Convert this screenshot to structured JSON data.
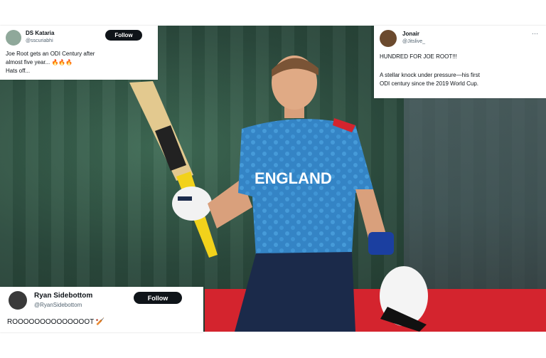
{
  "tweet_top_left": {
    "name": "DS Kataria",
    "verified_icon": "verified-badge-icon",
    "handle": "@sscuriabhi",
    "follow_label": "Follow",
    "text_line1": "Joe  Root gets an ODI Century after",
    "text_line2": "almost five year... 🔥🔥🔥",
    "text_line3": "Hats off..."
  },
  "tweet_top_right": {
    "name": "Jonair",
    "verified_icon": "verified-badge-icon",
    "handle": "@Jitslive_",
    "more_icon": "more-options-icon",
    "text_line1": "HUNDRED FOR JOE ROOT!!!",
    "text_line2": "A stellar knock under pressure—his first",
    "text_line3": "ODI century since the 2019 World Cup."
  },
  "tweet_bottom_left": {
    "name": "Ryan Sidebottom",
    "handle": "@RyanSidebottom",
    "follow_label": "Follow",
    "text": "ROOOOOOOOOOOOOOT 🏏"
  },
  "photo": {
    "jersey_text": "ENGLAND",
    "accent_jersey": "#3a8fd1",
    "accent_bat_grip": "#f2d21b"
  }
}
